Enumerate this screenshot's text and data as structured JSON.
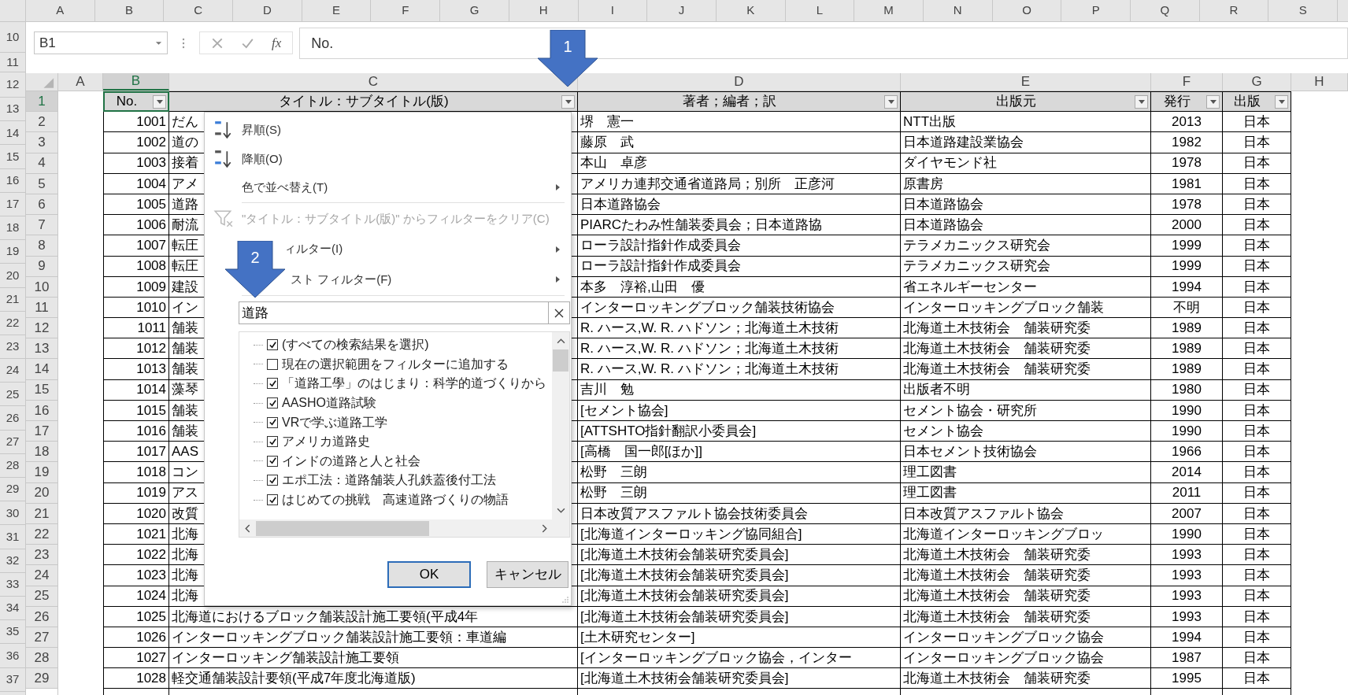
{
  "outer_sheet": {
    "column_headers": [
      "A",
      "B",
      "C",
      "D",
      "E",
      "F",
      "G",
      "H",
      "I",
      "J",
      "K",
      "L",
      "M",
      "N",
      "O",
      "P",
      "Q",
      "R",
      "S"
    ],
    "row_headers": [
      "10",
      "11",
      "12",
      "13",
      "14",
      "15",
      "16",
      "17",
      "18",
      "19",
      "20",
      "21",
      "22",
      "23",
      "24",
      "25",
      "26",
      "27",
      "28",
      "29",
      "30",
      "31",
      "32",
      "33",
      "34",
      "35",
      "36",
      "37"
    ]
  },
  "formula_bar": {
    "name_box": "B1",
    "function_button": "fx",
    "formula": "No."
  },
  "sheet": {
    "column_headers": [
      {
        "label": "A",
        "selected": false
      },
      {
        "label": "B",
        "selected": true
      },
      {
        "label": "C",
        "selected": false
      },
      {
        "label": "D",
        "selected": false
      },
      {
        "label": "E",
        "selected": false
      },
      {
        "label": "F",
        "selected": false
      },
      {
        "label": "G",
        "selected": false
      },
      {
        "label": "H",
        "selected": false
      }
    ],
    "header_row": {
      "row_number": "1",
      "selected": true,
      "cells": [
        {
          "text": "No.",
          "active": true
        },
        {
          "text": "タイトル：サブタイトル(版)",
          "active": false
        },
        {
          "text": "著者；編者；訳",
          "active": false
        },
        {
          "text": "出版元",
          "active": false
        },
        {
          "text": "発行",
          "active": false
        },
        {
          "text": "出版",
          "active": false
        }
      ]
    },
    "rows": [
      {
        "row_number": "2",
        "selected": false,
        "cells": [
          "1001",
          "だん",
          "堺　憲一",
          "NTT出版",
          "2013",
          "日本"
        ]
      },
      {
        "row_number": "3",
        "selected": false,
        "cells": [
          "1002",
          "道の",
          "藤原　武",
          "日本道路建設業協会",
          "1982",
          "日本"
        ]
      },
      {
        "row_number": "4",
        "selected": false,
        "cells": [
          "1003",
          "接着",
          "本山　卓彦",
          "ダイヤモンド社",
          "1978",
          "日本"
        ]
      },
      {
        "row_number": "5",
        "selected": false,
        "cells": [
          "1004",
          "アメ",
          "アメリカ連邦交通省道路局；別所　正彦河",
          "原書房",
          "1981",
          "日本"
        ]
      },
      {
        "row_number": "6",
        "selected": false,
        "cells": [
          "1005",
          "道路",
          "日本道路協会",
          "日本道路協会",
          "1978",
          "日本"
        ]
      },
      {
        "row_number": "7",
        "selected": false,
        "cells": [
          "1006",
          "耐流",
          "PIARCたわみ性舗装委員会；日本道路協",
          "日本道路協会",
          "2000",
          "日本"
        ]
      },
      {
        "row_number": "8",
        "selected": false,
        "cells": [
          "1007",
          "転圧",
          "ローラ設計指針作成委員会",
          "テラメカニックス研究会",
          "1999",
          "日本"
        ]
      },
      {
        "row_number": "9",
        "selected": false,
        "cells": [
          "1008",
          "転圧",
          "ローラ設計指針作成委員会",
          "テラメカニックス研究会",
          "1999",
          "日本"
        ]
      },
      {
        "row_number": "10",
        "selected": false,
        "cells": [
          "1009",
          "建設",
          "本多　淳裕,山田　優",
          "省エネルギーセンター",
          "1994",
          "日本"
        ]
      },
      {
        "row_number": "11",
        "selected": false,
        "cells": [
          "1010",
          "イン",
          "インターロッキングブロック舗装技術協会",
          "インターロッキングブロック舗装",
          "不明",
          "日本"
        ]
      },
      {
        "row_number": "12",
        "selected": false,
        "cells": [
          "1011",
          "舗装",
          "R. ハース,W. R. ハドソン；北海道土木技術",
          "北海道土木技術会　舗装研究委",
          "1989",
          "日本"
        ]
      },
      {
        "row_number": "13",
        "selected": false,
        "cells": [
          "1012",
          "舗装",
          "R. ハース,W. R. ハドソン；北海道土木技術",
          "北海道土木技術会　舗装研究委",
          "1989",
          "日本"
        ]
      },
      {
        "row_number": "14",
        "selected": false,
        "cells": [
          "1013",
          "舗装",
          "R. ハース,W. R. ハドソン；北海道土木技術",
          "北海道土木技術会　舗装研究委",
          "1989",
          "日本"
        ]
      },
      {
        "row_number": "15",
        "selected": false,
        "cells": [
          "1014",
          "藻琴",
          "吉川　勉",
          "出版者不明",
          "1980",
          "日本"
        ]
      },
      {
        "row_number": "16",
        "selected": false,
        "cells": [
          "1015",
          "舗装",
          "[セメント協会]",
          "セメント協会・研究所",
          "1990",
          "日本"
        ]
      },
      {
        "row_number": "17",
        "selected": false,
        "cells": [
          "1016",
          "舗装",
          "[ATTSHTO指針翻訳小委員会]",
          "セメント協会",
          "1990",
          "日本"
        ]
      },
      {
        "row_number": "18",
        "selected": false,
        "cells": [
          "1017",
          "AAS",
          "[高橋　国一郎[ほか]]",
          "日本セメント技術協会",
          "1966",
          "日本"
        ]
      },
      {
        "row_number": "19",
        "selected": false,
        "cells": [
          "1018",
          "コン",
          "松野　三朗",
          "理工図書",
          "2014",
          "日本"
        ]
      },
      {
        "row_number": "20",
        "selected": false,
        "cells": [
          "1019",
          "アス",
          "松野　三朗",
          "理工図書",
          "2011",
          "日本"
        ]
      },
      {
        "row_number": "21",
        "selected": false,
        "cells": [
          "1020",
          "改質",
          "日本改質アスファルト協会技術委員会",
          "日本改質アスファルト協会",
          "2007",
          "日本"
        ]
      },
      {
        "row_number": "22",
        "selected": false,
        "cells": [
          "1021",
          "北海",
          "[北海道インターロッキング協同組合]",
          "北海道インターロッキングブロッ",
          "1990",
          "日本"
        ]
      },
      {
        "row_number": "23",
        "selected": false,
        "cells": [
          "1022",
          "北海",
          "[北海道土木技術会舗装研究委員会]",
          "北海道土木技術会　舗装研究委",
          "1993",
          "日本"
        ]
      },
      {
        "row_number": "24",
        "selected": false,
        "cells": [
          "1023",
          "北海",
          "[北海道土木技術会舗装研究委員会]",
          "北海道土木技術会　舗装研究委",
          "1993",
          "日本"
        ]
      },
      {
        "row_number": "25",
        "selected": false,
        "cells": [
          "1024",
          "北海",
          "[北海道土木技術会舗装研究委員会]",
          "北海道土木技術会　舗装研究委",
          "1993",
          "日本"
        ]
      },
      {
        "row_number": "26",
        "selected": false,
        "cells": [
          "1025",
          "北海道におけるブロック舗装設計施工要領(平成4年",
          "[北海道土木技術会舗装研究委員会]",
          "北海道土木技術会　舗装研究委",
          "1993",
          "日本"
        ]
      },
      {
        "row_number": "27",
        "selected": false,
        "cells": [
          "1026",
          "インターロッキングブロック舗装設計施工要領：車道編",
          "[土木研究センター]",
          "インターロッキングブロック協会",
          "1994",
          "日本"
        ]
      },
      {
        "row_number": "28",
        "selected": false,
        "cells": [
          "1027",
          "インターロッキング舗装設計施工要領",
          "[インターロッキングブロック協会，インター",
          "インターロッキングブロック協会",
          "1987",
          "日本"
        ]
      },
      {
        "row_number": "29",
        "selected": false,
        "cells": [
          "1028",
          "軽交通舗装設計要領(平成7年度北海道版)",
          "[北海道土木技術会舗装研究委員会]",
          "北海道土木技術会　舗装研究委",
          "1995",
          "日本"
        ]
      }
    ]
  },
  "filter_menu": {
    "items": [
      {
        "kind": "sort-asc",
        "label": "昇順(S)",
        "disabled": false
      },
      {
        "kind": "sort-desc",
        "label": "降順(O)",
        "disabled": false
      },
      {
        "kind": "submenu",
        "label": "色で並べ替え(T)",
        "disabled": false
      },
      {
        "kind": "clear",
        "label": "\"タイトル：サブタイトル(版)\" からフィルターをクリア(C)",
        "disabled": true
      },
      {
        "kind": "submenu",
        "label": "ィルター(I)",
        "disabled": false
      },
      {
        "kind": "submenu",
        "label": "スト フィルター(F)",
        "disabled": false
      }
    ],
    "search": {
      "value": "道路"
    },
    "list": {
      "items": [
        {
          "label": "(すべての検索結果を選択)",
          "checked": true
        },
        {
          "label": "現在の選択範囲をフィルターに追加する",
          "checked": false
        },
        {
          "label": "「道路工學」のはじまり：科学的道づくりから",
          "checked": true
        },
        {
          "label": "AASHO道路試験",
          "checked": true
        },
        {
          "label": "VRで学ぶ道路工学",
          "checked": true
        },
        {
          "label": "アメリカ道路史",
          "checked": true
        },
        {
          "label": "インドの道路と人と社会",
          "checked": true
        },
        {
          "label": "エポ工法：道路舗装人孔鉄蓋後付工法",
          "checked": true
        },
        {
          "label": "はじめての挑戦　高速道路づくりの物語",
          "checked": true
        }
      ]
    },
    "buttons": [
      "OK",
      "キャンセル"
    ]
  },
  "annotations": [
    {
      "label": "1"
    },
    {
      "label": "2"
    }
  ]
}
